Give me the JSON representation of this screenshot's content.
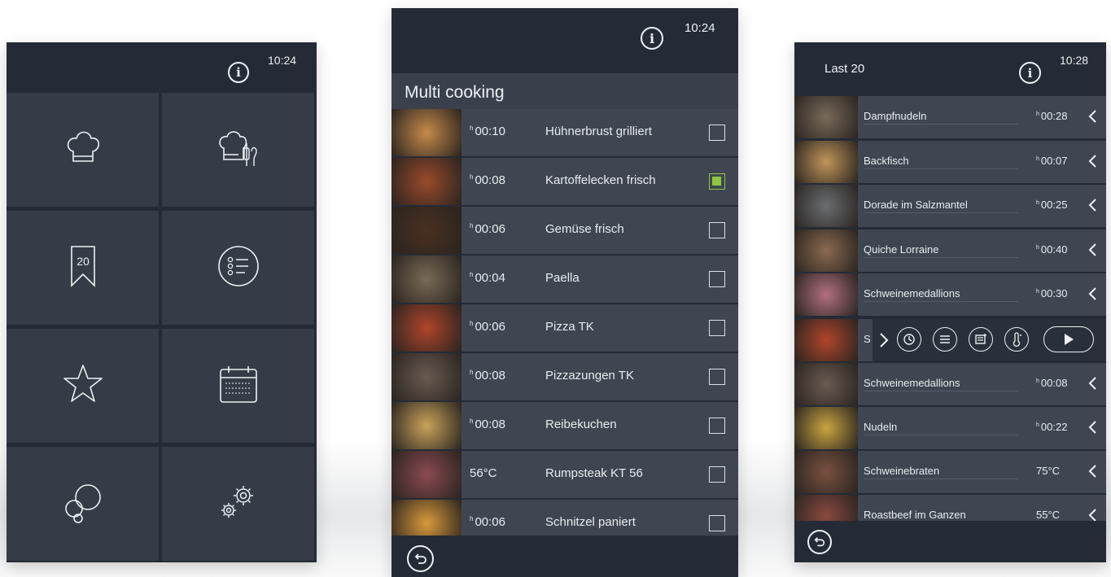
{
  "screen1": {
    "clock": "10:24",
    "info_icon": "info-icon",
    "tiles": [
      {
        "name": "chef-hat-icon"
      },
      {
        "name": "chef-tools-icon"
      },
      {
        "name": "last-20-bookmark-icon",
        "label": "20"
      },
      {
        "name": "list-menu-icon"
      },
      {
        "name": "star-icon"
      },
      {
        "name": "calendar-icon"
      },
      {
        "name": "bubbles-icon"
      },
      {
        "name": "settings-gears-icon"
      }
    ]
  },
  "screen2": {
    "clock": "10:24",
    "title": "Multi cooking",
    "rows": [
      {
        "time": "00:10",
        "time_unit": "h",
        "name": "Hühnerbrust grilliert",
        "checked": false,
        "thumb": "#c68a4a"
      },
      {
        "time": "00:08",
        "time_unit": "h",
        "name": "Kartoffelecken frisch",
        "checked": true,
        "thumb": "#9a4a2a"
      },
      {
        "time": "00:06",
        "time_unit": "h",
        "name": "Gemüse frisch",
        "checked": false,
        "thumb": "#4a3020"
      },
      {
        "time": "00:04",
        "time_unit": "h",
        "name": "Paella",
        "checked": false,
        "thumb": "#7a6a55"
      },
      {
        "time": "00:06",
        "time_unit": "h",
        "name": "Pizza TK",
        "checked": false,
        "thumb": "#b0452a"
      },
      {
        "time": "00:08",
        "time_unit": "h",
        "name": "Pizzazungen TK",
        "checked": false,
        "thumb": "#6a5a50"
      },
      {
        "time": "00:08",
        "time_unit": "h",
        "name": "Reibekuchen",
        "checked": false,
        "thumb": "#c9a25a"
      },
      {
        "time": "56°C",
        "time_unit": "",
        "name": "Rumpsteak KT 56",
        "checked": false,
        "thumb": "#8a4a50"
      },
      {
        "time": "00:06",
        "time_unit": "h",
        "name": "Schnitzel paniert",
        "checked": false,
        "thumb": "#d99a3a"
      }
    ]
  },
  "screen3": {
    "clock": "10:28",
    "title": "Last 20",
    "rows": [
      {
        "name": "Dampfnudeln",
        "value": "00:28",
        "unit": "h",
        "thumb": "#7a6a5a"
      },
      {
        "name": "Backfisch",
        "value": "00:07",
        "unit": "h",
        "thumb": "#c0955a"
      },
      {
        "name": "Dorade im Salzmantel",
        "value": "00:25",
        "unit": "h",
        "thumb": "#6a6e72"
      },
      {
        "name": "Quiche Lorraine",
        "value": "00:40",
        "unit": "h",
        "thumb": "#8a6a50"
      },
      {
        "name": "Schweinemedallions",
        "value": "00:30",
        "unit": "h",
        "thumb": "#b07080"
      }
    ],
    "active_row": {
      "name_partial": "S",
      "thumb": "#b0452a",
      "actions": [
        "timer-icon",
        "menu-lines-icon",
        "program-add-icon",
        "thermometer-icon",
        "play-icon"
      ]
    },
    "rows_after": [
      {
        "name": "Schweinemedallions",
        "value": "00:08",
        "unit": "h",
        "thumb": "#6a5a50"
      },
      {
        "name": "Nudeln",
        "value": "00:22",
        "unit": "h",
        "thumb": "#c9a540"
      },
      {
        "name": "Schweinebraten",
        "value": "75°C",
        "unit": "",
        "thumb": "#7a5040"
      },
      {
        "name": "Roastbeef im Ganzen",
        "value": "55°C",
        "unit": "",
        "thumb": "#8a4a40"
      }
    ]
  }
}
